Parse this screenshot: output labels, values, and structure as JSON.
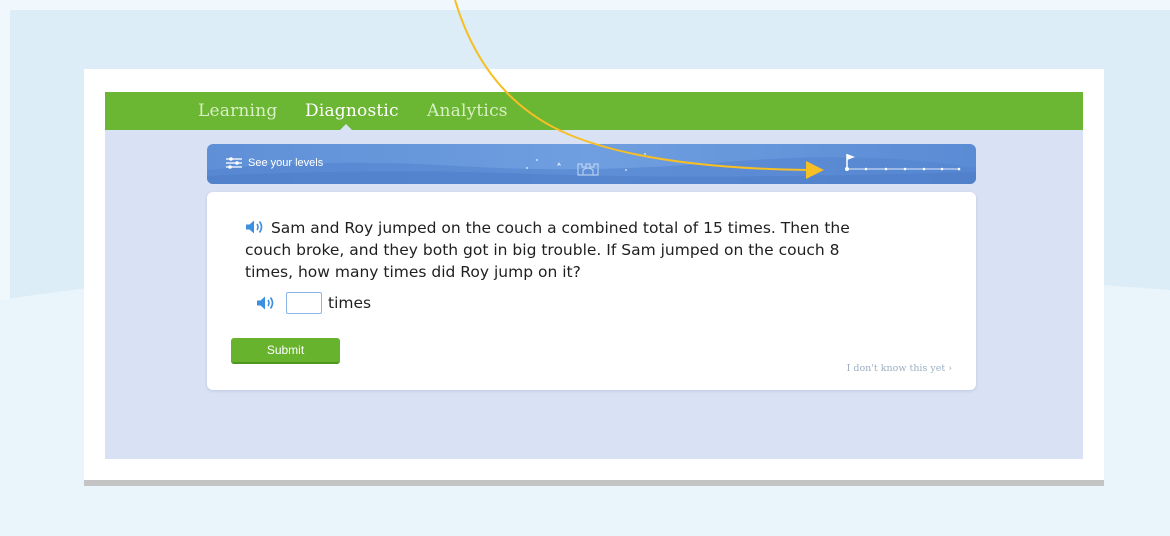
{
  "nav": {
    "tabs": [
      {
        "label": "Learning",
        "active": false
      },
      {
        "label": "Diagnostic",
        "active": true
      },
      {
        "label": "Analytics",
        "active": false
      }
    ]
  },
  "levels_bar": {
    "link_label": "See your levels"
  },
  "question": {
    "text": "Sam and Roy jumped on the couch a combined total of 15 times. Then the couch broke, and they both got in big trouble. If Sam jumped on the couch 8 times, how many times did Roy jump on it?"
  },
  "answer": {
    "value": "",
    "unit": "times"
  },
  "actions": {
    "submit_label": "Submit",
    "dont_know_label": "I don't know this yet ›"
  },
  "colors": {
    "nav_green": "#6bb633",
    "submit_green": "#67b32e",
    "levels_blue": "#6f9fe0",
    "speaker_blue": "#3d8fe0",
    "annotation_arrow": "#f6bf26"
  }
}
